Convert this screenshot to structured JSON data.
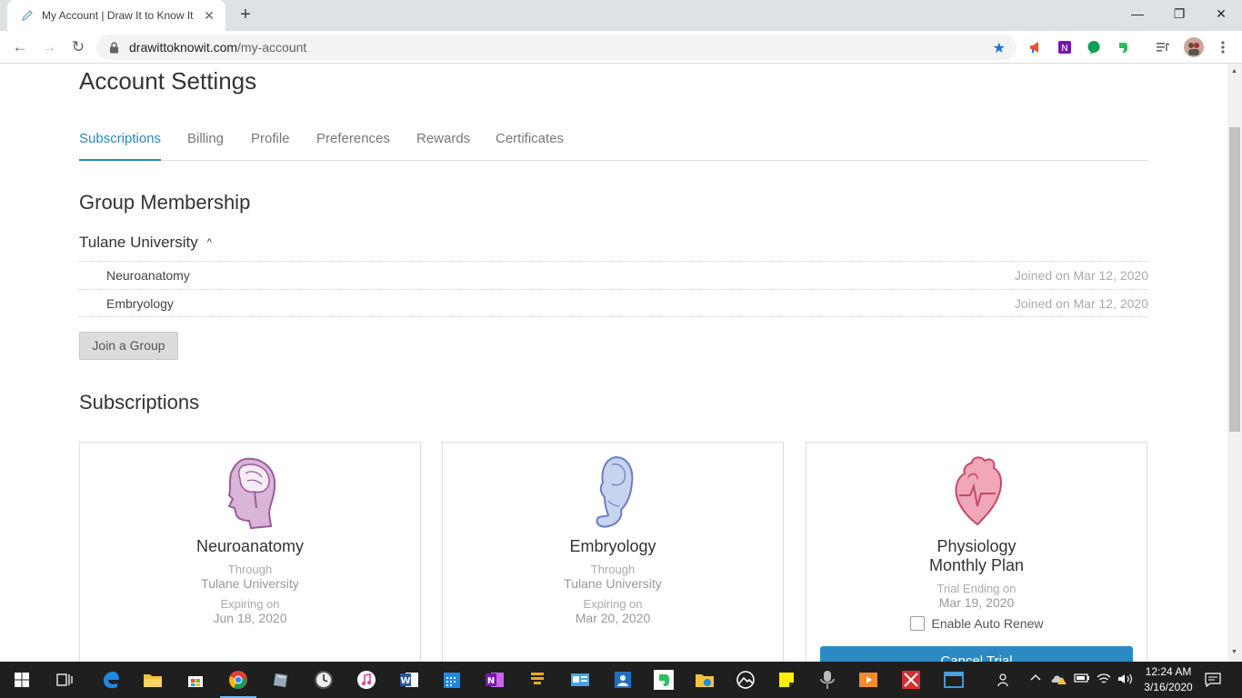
{
  "browser": {
    "tab_title": "My Account | Draw It to Know It",
    "tab_close": "✕",
    "new_tab": "+",
    "url_host": "drawittoknowit.com",
    "url_path": "/my-account",
    "window_controls": {
      "minimize": "—",
      "maximize": "❐",
      "close": "✕"
    }
  },
  "page": {
    "title": "Account Settings",
    "tabs": [
      {
        "label": "Subscriptions"
      },
      {
        "label": "Billing"
      },
      {
        "label": "Profile"
      },
      {
        "label": "Preferences"
      },
      {
        "label": "Rewards"
      },
      {
        "label": "Certificates"
      }
    ],
    "group_section": {
      "heading": "Group Membership",
      "group_name": "Tulane University",
      "caret": "^",
      "courses": [
        {
          "name": "Neuroanatomy",
          "joined": "Joined on Mar 12, 2020"
        },
        {
          "name": "Embryology",
          "joined": "Joined on Mar 12, 2020"
        }
      ],
      "join_button": "Join a Group"
    },
    "subscriptions": {
      "heading": "Subscriptions",
      "cards": [
        {
          "title": "Neuroanatomy",
          "via_label": "Through",
          "via": "Tulane University",
          "date_label": "Expiring on",
          "date": "Jun 18, 2020",
          "icon": "head-brain-icon"
        },
        {
          "title": "Embryology",
          "via_label": "Through",
          "via": "Tulane University",
          "date_label": "Expiring on",
          "date": "Mar 20, 2020",
          "icon": "embryo-icon"
        },
        {
          "title": "Physiology",
          "subtitle": "Monthly Plan",
          "date_label": "Trial Ending on",
          "date": "Mar 19, 2020",
          "renew_label": "Enable Auto Renew",
          "cancel_button": "Cancel Trial",
          "icon": "heart-icon"
        }
      ]
    }
  },
  "taskbar": {
    "time": "12:24 AM",
    "date": "3/16/2020"
  },
  "colors": {
    "accent": "#2c87b9",
    "button_blue": "#2b8ac4",
    "taskbar": "#1f1f1f"
  }
}
